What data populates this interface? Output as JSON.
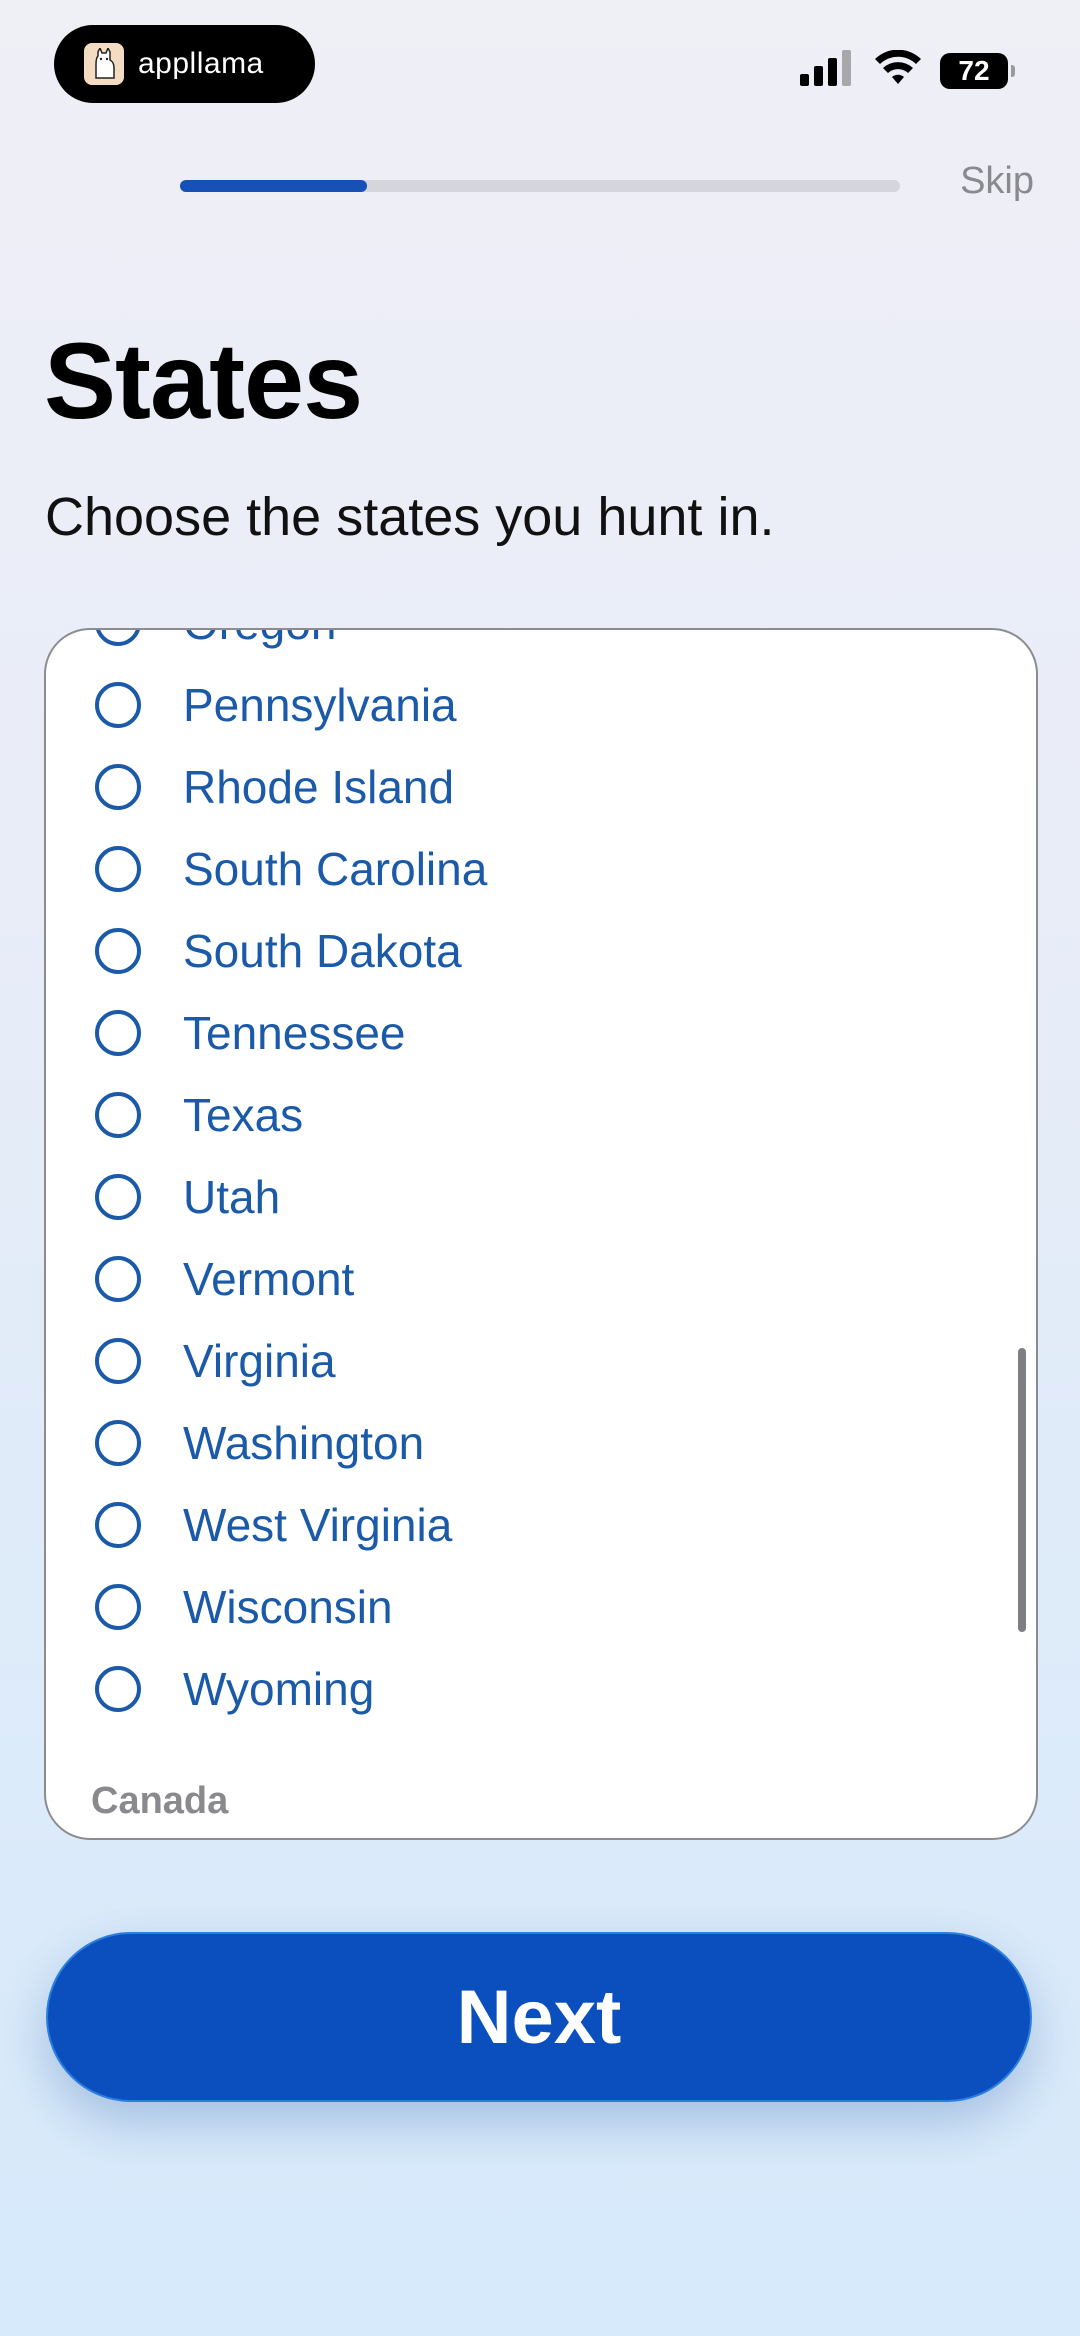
{
  "status_bar": {
    "app_name": "appllama",
    "battery": "72",
    "icons": [
      "signal-icon",
      "wifi-icon",
      "battery-icon"
    ]
  },
  "progress": {
    "value": 0.26
  },
  "header": {
    "skip_label": "Skip"
  },
  "main": {
    "title": "States",
    "subtitle": "Choose the states you hunt in.",
    "states": [
      "Oregon",
      "Pennsylvania",
      "Rhode Island",
      "South Carolina",
      "South Dakota",
      "Tennessee",
      "Texas",
      "Utah",
      "Vermont",
      "Virginia",
      "Washington",
      "West Virginia",
      "Wisconsin",
      "Wyoming"
    ],
    "next_section_header": "Canada"
  },
  "footer": {
    "next_label": "Next"
  },
  "colors": {
    "accent": "#0b4fbf",
    "progress_fill": "#1751b8",
    "item_text": "#1b5aa8"
  }
}
